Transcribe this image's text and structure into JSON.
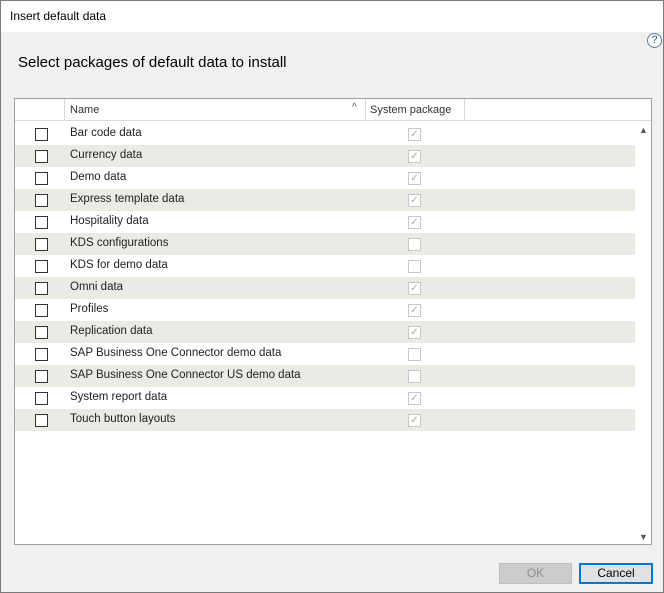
{
  "window": {
    "title": "Insert default data"
  },
  "header": {
    "heading": "Select packages of default data to install",
    "help_glyph": "?"
  },
  "grid": {
    "columns": {
      "name": "Name",
      "system": "System package"
    },
    "rows": [
      {
        "name": "Bar code data",
        "selected": false,
        "system": true
      },
      {
        "name": "Currency data",
        "selected": false,
        "system": true
      },
      {
        "name": "Demo data",
        "selected": false,
        "system": true
      },
      {
        "name": "Express template data",
        "selected": false,
        "system": true
      },
      {
        "name": "Hospitality data",
        "selected": false,
        "system": true
      },
      {
        "name": "KDS configurations",
        "selected": false,
        "system": false
      },
      {
        "name": "KDS for demo data",
        "selected": false,
        "system": false
      },
      {
        "name": "Omni data",
        "selected": false,
        "system": true
      },
      {
        "name": "Profiles",
        "selected": false,
        "system": true
      },
      {
        "name": "Replication data",
        "selected": false,
        "system": true
      },
      {
        "name": "SAP Business One Connector demo data",
        "selected": false,
        "system": false
      },
      {
        "name": "SAP Business One Connector US demo data",
        "selected": false,
        "system": false
      },
      {
        "name": "System report data",
        "selected": false,
        "system": true
      },
      {
        "name": "Touch button layouts",
        "selected": false,
        "system": true
      }
    ]
  },
  "buttons": {
    "ok": "OK",
    "cancel": "Cancel"
  }
}
